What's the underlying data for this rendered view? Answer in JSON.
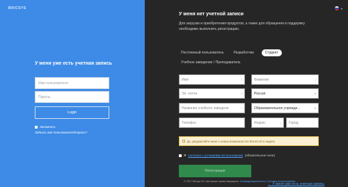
{
  "left": {
    "logo": "BRICSYS",
    "title": "У меня уже есть учетная запись",
    "username_placeholder": "Имя пользователя",
    "password_placeholder": "Пароль",
    "login_label": "Login",
    "remember_label": "Запомнить",
    "forgot_label": "Забыли имя пользователя/пароль?"
  },
  "right": {
    "language": "▾",
    "title": "У меня нет учетной записи",
    "description": "Для загрузки и приобретения продуктов, а также для обращения в поддержку необходимо выполнить регистрацию.",
    "tabs": [
      {
        "label": "Постоянный пользователь"
      },
      {
        "label": "Разработчик"
      },
      {
        "label": "Студент",
        "active": true
      }
    ],
    "tab_second_row": "Учебное заведение / Преподаватель",
    "fields": {
      "first_name": "Имя",
      "last_name": "Фамилия",
      "email": "Эл. почта",
      "country": "Россия",
      "institution_name": "Название учебного заведени",
      "institution_type": "Образовательное учрежде...",
      "phone": "Телефон",
      "zip": "Индекс",
      "city": "Город"
    },
    "consent_text": "Да, уведомляйте меня о новых возможностях BricsCAD и акциях.",
    "terms_prefix": "Я",
    "terms_link": "согласен с условиями использования",
    "terms_suffix": "(обязательное поле)",
    "register_label": "Регистрация",
    "footer_text": "© 2017 Bricsys NV. Авторские права защищены.",
    "footer_links": "Конфиденциальность | Условия использования",
    "have_account": "← У меня уже есть учетная запись"
  },
  "colors": {
    "left_bg": "#3d8be6",
    "right_bg": "#262626",
    "register_bg": "#2f8a4c",
    "link": "#4da3ff",
    "consent_bg": "#fbf1d2"
  }
}
